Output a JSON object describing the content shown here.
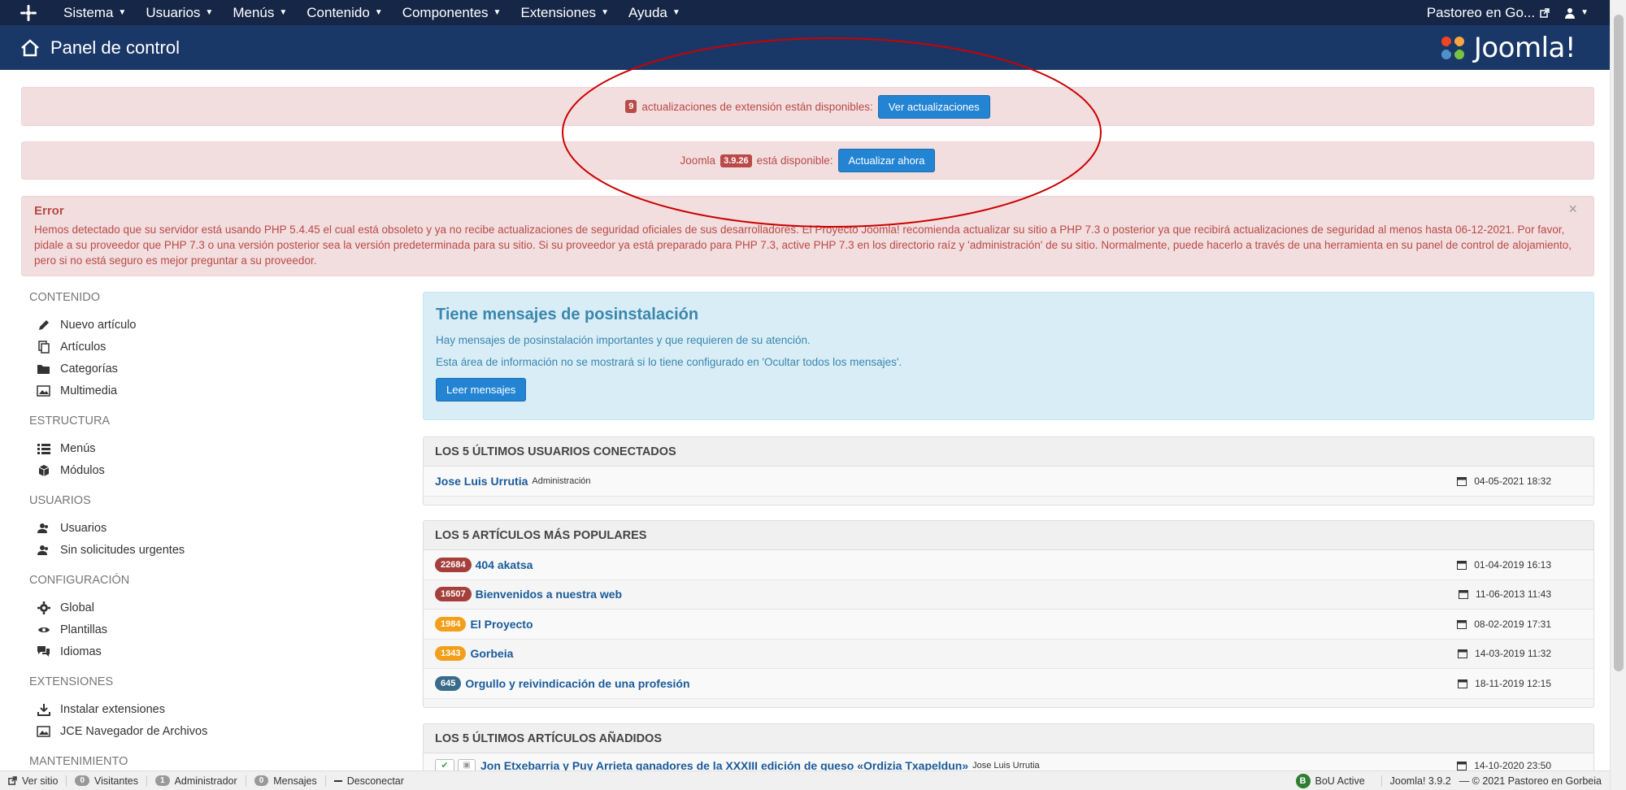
{
  "topbar": {
    "menus": [
      "Sistema",
      "Usuarios",
      "Menús",
      "Contenido",
      "Componentes",
      "Extensiones",
      "Ayuda"
    ],
    "site_name": "Pastoreo en Go...",
    "logo_icon": "joomla-icon",
    "external_icon": "external-link-icon",
    "user_icon": "user-icon"
  },
  "header": {
    "title": "Panel de control",
    "home_icon": "home-icon",
    "brand": "Joomla!"
  },
  "alerts": {
    "extensions": {
      "count": "9",
      "text": "actualizaciones de extensión están disponibles:",
      "button": "Ver actualizaciones"
    },
    "core": {
      "prefix": "Joomla",
      "version": "3.9.26",
      "text": "está disponible:",
      "button": "Actualizar ahora"
    },
    "error": {
      "title": "Error",
      "message": "Hemos detectado que su servidor está usando PHP 5.4.45 el cual está obsoleto y ya no recibe actualizaciones de seguridad oficiales de sus desarrolladores. El Proyecto Joomla! recomienda actualizar su sitio a PHP 7.3 o posterior ya que recibirá actualizaciones de seguridad al menos hasta 06-12-2021. Por favor, pidale a su proveedor que PHP 7.3 o una versión posterior sea la versión predeterminada para su sitio. Si su proveedor ya está preparado para PHP 7.3, active PHP 7.3 en los directorio raíz y 'administración' de su sitio. Normalmente, puede hacerlo a través de una herramienta en su panel de control de alojamiento, pero si no está seguro es mejor preguntar a su proveedor.",
      "close": "×"
    }
  },
  "sidebar": {
    "sections": [
      {
        "title": "CONTENIDO",
        "items": [
          {
            "label": "Nuevo artículo",
            "icon": "pencil-icon"
          },
          {
            "label": "Artículos",
            "icon": "copy-icon"
          },
          {
            "label": "Categorías",
            "icon": "folder-icon"
          },
          {
            "label": "Multimedia",
            "icon": "image-icon"
          }
        ]
      },
      {
        "title": "ESTRUCTURA",
        "items": [
          {
            "label": "Menús",
            "icon": "list-icon"
          },
          {
            "label": "Módulos",
            "icon": "cube-icon"
          }
        ]
      },
      {
        "title": "USUARIOS",
        "items": [
          {
            "label": "Usuarios",
            "icon": "users-icon"
          },
          {
            "label": "Sin solicitudes urgentes",
            "icon": "users-icon"
          }
        ]
      },
      {
        "title": "CONFIGURACIÓN",
        "items": [
          {
            "label": "Global",
            "icon": "gear-icon"
          },
          {
            "label": "Plantillas",
            "icon": "eye-icon"
          },
          {
            "label": "Idiomas",
            "icon": "comments-icon"
          }
        ]
      },
      {
        "title": "EXTENSIONES",
        "items": [
          {
            "label": "Instalar extensiones",
            "icon": "download-icon"
          },
          {
            "label": "JCE Navegador de Archivos",
            "icon": "image-icon"
          }
        ]
      },
      {
        "title": "MANTENIMIENTO",
        "items": []
      }
    ]
  },
  "postinstall": {
    "title": "Tiene mensajes de posinstalación",
    "line1": "Hay mensajes de posinstalación importantes y que requieren de su atención.",
    "line2": "Esta área de información no se mostrará si lo tiene configurado en 'Ocultar todos los mensajes'.",
    "button": "Leer mensajes"
  },
  "logged_users": {
    "title": "LOS 5 ÚLTIMOS USUARIOS CONECTADOS",
    "rows": [
      {
        "name": "Jose Luis Urrutia",
        "role": "Administración",
        "date": "04-05-2021 18:32"
      }
    ]
  },
  "popular": {
    "title": "LOS 5 ARTÍCULOS MÁS POPULARES",
    "rows": [
      {
        "hits": "22684",
        "level": "red",
        "title": "404 akatsa",
        "date": "01-04-2019 16:13"
      },
      {
        "hits": "16507",
        "level": "red",
        "title": "Bienvenidos a nuestra web",
        "date": "11-06-2013 11:43"
      },
      {
        "hits": "1984",
        "level": "orange",
        "title": "El Proyecto",
        "date": "08-02-2019 17:31"
      },
      {
        "hits": "1343",
        "level": "orange",
        "title": "Gorbeia",
        "date": "14-03-2019 11:32"
      },
      {
        "hits": "645",
        "level": "blue",
        "title": "Orgullo y reivindicación de una profesión",
        "date": "18-11-2019 12:15"
      }
    ]
  },
  "latest": {
    "title": "LOS 5 ÚLTIMOS ARTÍCULOS AÑADIDOS",
    "rows": [
      {
        "title": "Jon Etxebarria y Puy Arrieta ganadores de la XXXIII edición de queso «Ordizia Txapeldun»",
        "author": "Jose Luis Urrutia",
        "date": "14-10-2020 23:50"
      }
    ]
  },
  "statusbar": {
    "view_site": "Ver sitio",
    "visitors_count": "0",
    "visitors": "Visitantes",
    "admins_count": "1",
    "admins": "Administrador",
    "messages_count": "0",
    "messages": "Mensajes",
    "logout": "Desconectar",
    "bou": "BoU Active",
    "version": "Joomla! 3.9.2",
    "copyright": "— © 2021 Pastoreo en Gorbeia"
  },
  "colors": {
    "topbar": "#152646",
    "header": "#1a3867",
    "alert_bg": "#f2dede",
    "alert_text": "#b94a48",
    "button_blue": "#2384d3",
    "info_bg": "#d9edf7",
    "annotation": "#cc0000"
  }
}
